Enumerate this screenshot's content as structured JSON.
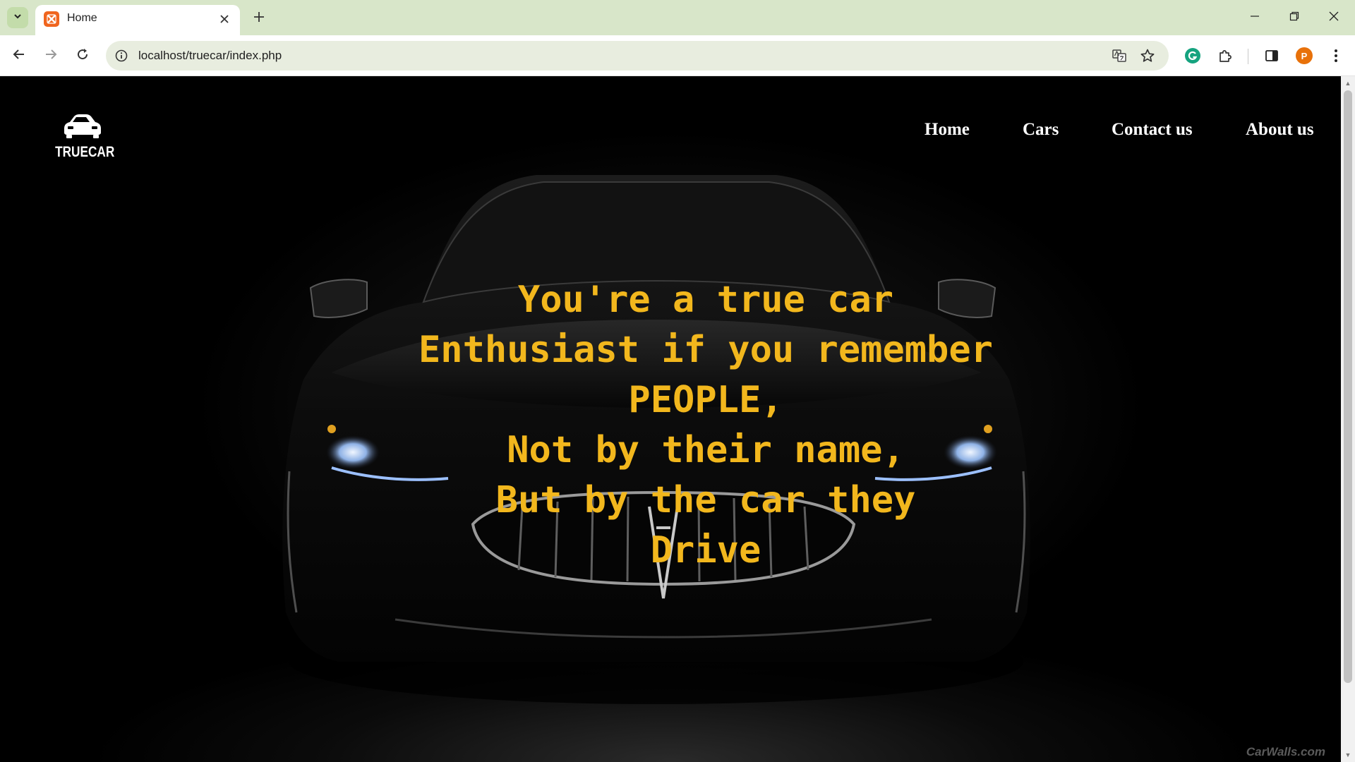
{
  "browser": {
    "tab_title": "Home",
    "url": "localhost/truecar/index.php",
    "profile_initial": "P",
    "icons": {
      "tab_search": "chevron-down-icon",
      "favicon": "xampp-icon",
      "tab_close": "close-icon",
      "new_tab": "plus-icon",
      "back": "arrow-left-icon",
      "forward": "arrow-right-icon",
      "reload": "reload-icon",
      "site_info": "info-icon",
      "translate": "translate-icon",
      "bookmark": "star-icon",
      "grammarly": "grammarly-icon",
      "extensions": "puzzle-icon",
      "side_panel": "side-panel-icon",
      "menu": "kebab-menu-icon"
    }
  },
  "site": {
    "logo_text": "TRUECAR",
    "nav": [
      {
        "label": "Home"
      },
      {
        "label": "Cars"
      },
      {
        "label": "Contact us"
      },
      {
        "label": "About us"
      }
    ],
    "hero_lines": [
      "You're a true car",
      "Enthusiast if you remember",
      "PEOPLE,",
      "Not by their name,",
      "But by the car they",
      "Drive"
    ],
    "watermark": "CarWalls.com"
  },
  "colors": {
    "hero_text": "#f2b71d",
    "nav_text": "#ffffff",
    "page_background": "#000000",
    "tabbar": "#d8e6c9",
    "omnibox": "#e8eddf",
    "avatar": "#e8710a"
  }
}
